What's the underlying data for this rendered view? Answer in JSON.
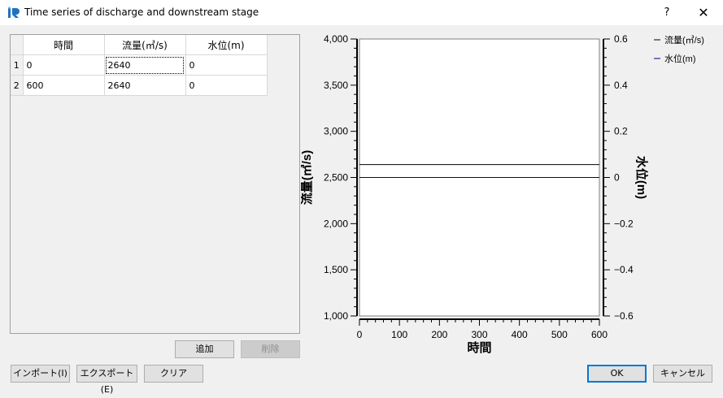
{
  "window": {
    "title": "Time series of discharge and downstream stage",
    "help_label": "?",
    "close_label": "✕"
  },
  "table": {
    "headers": [
      "時間",
      "流量(㎥/s)",
      "水位(m)"
    ],
    "rows": [
      {
        "index": "1",
        "time": "0",
        "discharge": "2640",
        "stage": "0"
      },
      {
        "index": "2",
        "time": "600",
        "discharge": "2640",
        "stage": "0"
      }
    ]
  },
  "buttons": {
    "add": "追加",
    "delete": "削除",
    "import": "インポート(I)",
    "export": "エクスポート(E)",
    "clear": "クリア",
    "ok": "OK",
    "cancel": "キャンセル"
  },
  "colors": {
    "discharge_line": "#000000",
    "stage_line": "#000080"
  },
  "chart_data": {
    "type": "line",
    "x": [
      0,
      600
    ],
    "series": [
      {
        "name": "流量(㎥/s)",
        "axis": "left",
        "values": [
          2640,
          2640
        ]
      },
      {
        "name": "水位(m)",
        "axis": "right",
        "values": [
          0,
          0
        ]
      }
    ],
    "xlabel": "時間",
    "ylabel_left": "流量(㎥/s)",
    "ylabel_right": "水位(m)",
    "xlim": [
      0,
      600
    ],
    "ylim_left": [
      1000,
      4000
    ],
    "ylim_right": [
      -0.6,
      0.6
    ],
    "xticks": [
      "0",
      "100",
      "200",
      "300",
      "400",
      "500",
      "600"
    ],
    "yticks_left": [
      "1,000",
      "1,500",
      "2,000",
      "2,500",
      "3,000",
      "3,500",
      "4,000"
    ],
    "yticks_right": [
      "-0.6",
      "-0.4",
      "-0.2",
      "0",
      "0.2",
      "0.4",
      "0.6"
    ],
    "grid": false,
    "legend": "top-right"
  }
}
